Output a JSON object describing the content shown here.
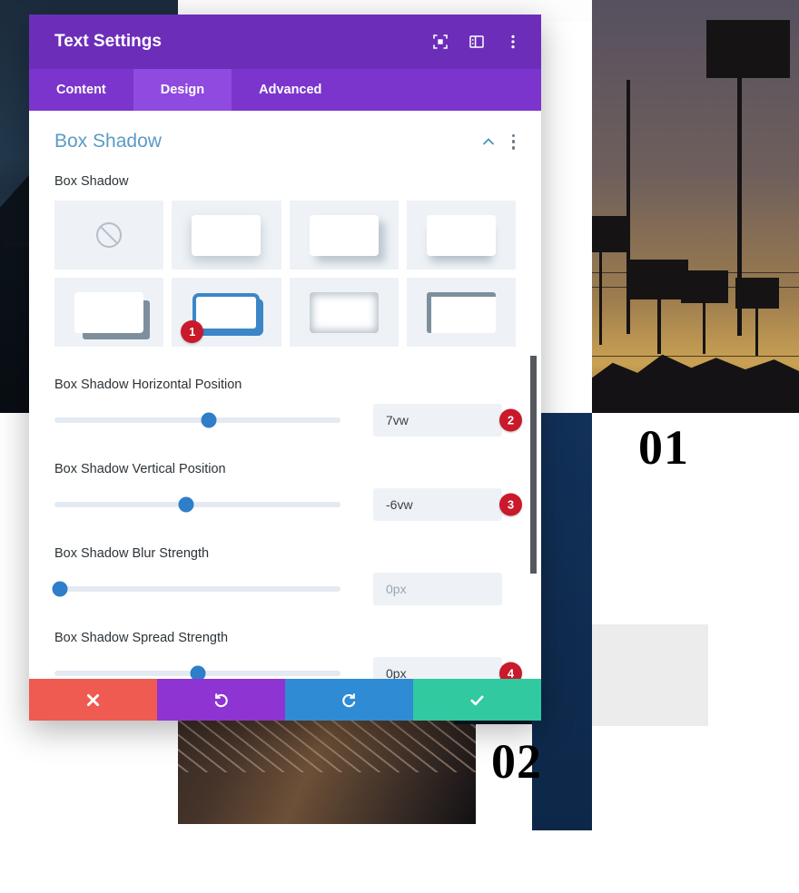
{
  "modal": {
    "title": "Text Settings",
    "header_icons": [
      {
        "name": "focus-target-icon",
        "label": "Focus"
      },
      {
        "name": "layout-columns-icon",
        "label": "Layout"
      },
      {
        "name": "more-options-icon",
        "label": "More Options"
      }
    ],
    "tabs": [
      {
        "label": "Content",
        "active": false
      },
      {
        "label": "Design",
        "active": true
      },
      {
        "label": "Advanced",
        "active": false
      }
    ],
    "section": {
      "title": "Box Shadow",
      "collapse_icon": "chevron-up-icon",
      "menu_icon": "more-options-icon"
    },
    "presets_field_label": "Box Shadow",
    "presets": [
      {
        "id": "none",
        "style": "none",
        "selected": false,
        "badge": null
      },
      {
        "id": "soft",
        "style": "s1",
        "selected": false,
        "badge": null
      },
      {
        "id": "offset",
        "style": "s2",
        "selected": false,
        "badge": null
      },
      {
        "id": "bottom",
        "style": "s3",
        "selected": false,
        "badge": null
      },
      {
        "id": "hard",
        "style": "s4",
        "selected": false,
        "badge": null
      },
      {
        "id": "outline",
        "style": "s5",
        "selected": true,
        "badge": "1"
      },
      {
        "id": "inset",
        "style": "s6",
        "selected": false,
        "badge": null
      },
      {
        "id": "corner",
        "style": "s7",
        "selected": false,
        "badge": null
      }
    ],
    "sliders": [
      {
        "label": "Box Shadow Horizontal Position",
        "value": "7vw",
        "is_placeholder": false,
        "thumb_percent": 54,
        "badge": "2"
      },
      {
        "label": "Box Shadow Vertical Position",
        "value": "-6vw",
        "is_placeholder": false,
        "thumb_percent": 46,
        "badge": "3"
      },
      {
        "label": "Box Shadow Blur Strength",
        "value": "0px",
        "is_placeholder": true,
        "thumb_percent": 2,
        "badge": null
      },
      {
        "label": "Box Shadow Spread Strength",
        "value": "0px",
        "is_placeholder": false,
        "thumb_percent": 50,
        "badge": "4"
      }
    ],
    "footer_buttons": [
      {
        "name": "cancel-button",
        "icon": "close-icon",
        "class": "cancel"
      },
      {
        "name": "undo-button",
        "icon": "undo-icon",
        "class": "undo"
      },
      {
        "name": "redo-button",
        "icon": "redo-icon",
        "class": "redo"
      },
      {
        "name": "save-button",
        "icon": "check-icon",
        "class": "save"
      }
    ]
  },
  "background": {
    "labels": [
      {
        "text": "01"
      },
      {
        "text": "02"
      }
    ]
  },
  "colors": {
    "header_purple": "#6c2eb9",
    "tabs_purple": "#7b35cc",
    "tab_active_purple": "#8f4ae0",
    "section_title_blue": "#5a9ac7",
    "slider_thumb_blue": "#2f7ec9",
    "badge_red": "#c9192b",
    "cancel_red": "#ef5a51",
    "undo_purple": "#8e34d3",
    "redo_blue": "#2f8bd4",
    "save_teal": "#31c9a0"
  }
}
